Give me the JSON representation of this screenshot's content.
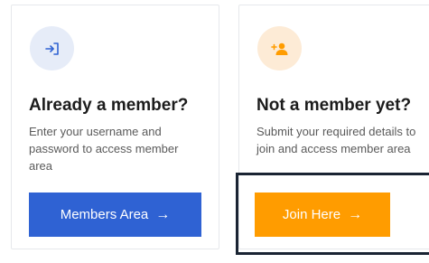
{
  "cards": {
    "existing": {
      "icon": "login-icon",
      "icon_color": "#2f62d3",
      "title": "Already a member?",
      "description": "Enter your username and password to access member area",
      "button_label": "Members Area",
      "button_arrow": "→",
      "button_color": "#2f62d3"
    },
    "new": {
      "icon": "add-user-icon",
      "icon_color": "#ff9c00",
      "title": "Not a member yet?",
      "description": "Submit your required details to join and access member area",
      "button_label": "Join Here",
      "button_arrow": "→",
      "button_color": "#ff9c00"
    }
  },
  "focus_highlight_color": "#1a2433"
}
